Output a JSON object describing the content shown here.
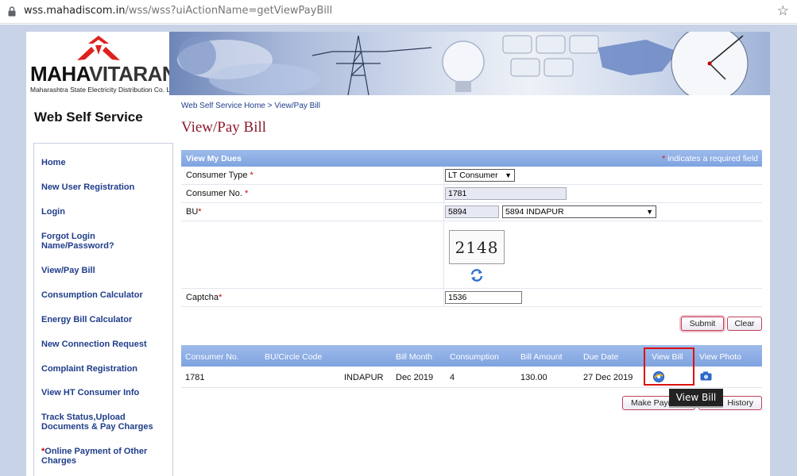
{
  "browser": {
    "url_host": "wss.mahadiscom.in",
    "url_path": "/wss/wss?uiActionName=getViewPayBill"
  },
  "logo": {
    "maha": "MAHA",
    "vitaran": "VITARAN",
    "subtitle": "Maharashtra State Electricity Distribution Co. Ltd."
  },
  "sidebar": {
    "title": "Web Self Service",
    "items": [
      {
        "label": "Home"
      },
      {
        "label": "New User Registration"
      },
      {
        "label": "Login"
      },
      {
        "label": "Forgot Login Name/Password?"
      },
      {
        "label": "View/Pay Bill"
      },
      {
        "label": "Consumption Calculator"
      },
      {
        "label": "Energy Bill Calculator"
      },
      {
        "label": "New Connection Request"
      },
      {
        "label": "Complaint Registration"
      },
      {
        "label": "View HT Consumer Info"
      },
      {
        "label": "Track Status,Upload Documents & Pay Charges"
      },
      {
        "prefix": "*",
        "label": "Online Payment of Other Charges"
      }
    ]
  },
  "breadcrumb": {
    "home": "Web Self Service Home",
    "sep": ">",
    "current": "View/Pay Bill"
  },
  "page_title": "View/Pay Bill",
  "dues": {
    "header": "View My Dues",
    "required_mark": "*",
    "required_note": "indicates a required field",
    "consumer_type_label": "Consumer Type",
    "consumer_type_value": "LT Consumer",
    "consumer_no_label": "Consumer No.",
    "consumer_no_value": "1781",
    "bu_label": "BU",
    "bu_code": "5894",
    "bu_select": "5894 INDAPUR",
    "captcha_image_text": "2148",
    "captcha_label": "Captcha",
    "captcha_value": "1536",
    "submit_label": "Submit",
    "clear_label": "Clear"
  },
  "results": {
    "headers": [
      "Consumer No.",
      "BU/Circle Code",
      "Bill Month",
      "Consumption",
      "Bill Amount",
      "Due Date",
      "View Bill",
      "View Photo"
    ],
    "row": {
      "consumer_no": "1781",
      "circle": "INDAPUR",
      "bill_month": "Dec 2019",
      "consumption": "4",
      "bill_amount": "130.00",
      "due_date": "27 Dec 2019"
    },
    "make_payment_label": "Make Payment",
    "history_label": "History",
    "tooltip": "View Bill"
  },
  "colors": {
    "nav_link": "#1f3d8a",
    "title": "#8b1a2b",
    "header_blue": "#7fa3e0",
    "highlight": "#dd1111"
  },
  "icons": [
    "lock-icon",
    "star-icon",
    "refresh-icon",
    "view-bill-icon",
    "camera-icon",
    "dropdown-arrow-icon"
  ]
}
